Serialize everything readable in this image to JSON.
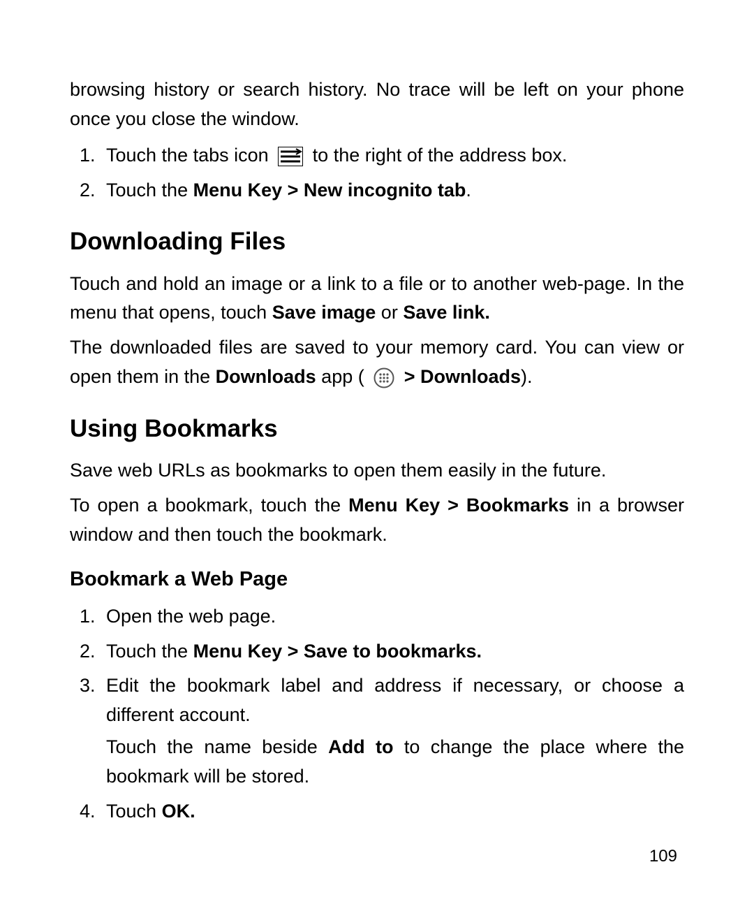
{
  "intro_para": "browsing history or search history. No trace will be left on your phone once you close the window.",
  "incognito_steps": {
    "s1a": "Touch the tabs icon ",
    "s1b": " to the right of the address box.",
    "s2a": "Touch the ",
    "s2b": "Menu Key > New incognito tab",
    "s2c": "."
  },
  "downloading": {
    "heading": "Downloading Files",
    "p1a": "Touch and hold an image or a link to a file or to another web-page. In the menu that opens, touch ",
    "p1b": "Save image",
    "p1c": " or ",
    "p1d": "Save link.",
    "p2a": "The downloaded files are saved to your memory card. You can view or open them in the ",
    "p2b": "Downloads",
    "p2c": " app ( ",
    "p2d": " > Downloads",
    "p2e": ")."
  },
  "bookmarks": {
    "heading": "Using Bookmarks",
    "p1": "Save web URLs as bookmarks to open them easily in the future.",
    "p2a": "To open a bookmark, touch the ",
    "p2b": "Menu Key > Bookmarks",
    "p2c": " in a browser window and then touch the bookmark.",
    "sub_heading": "Bookmark a Web Page",
    "steps": {
      "s1": "Open the web page.",
      "s2a": "Touch the ",
      "s2b": "Menu Key > Save to bookmarks.",
      "s3a": "Edit the bookmark label and address if necessary, or choose a different account.",
      "s3b_a": "Touch the name beside ",
      "s3b_b": "Add to",
      "s3b_c": " to change the place where the bookmark will be stored.",
      "s4a": "Touch ",
      "s4b": "OK."
    }
  },
  "page_number": "109"
}
